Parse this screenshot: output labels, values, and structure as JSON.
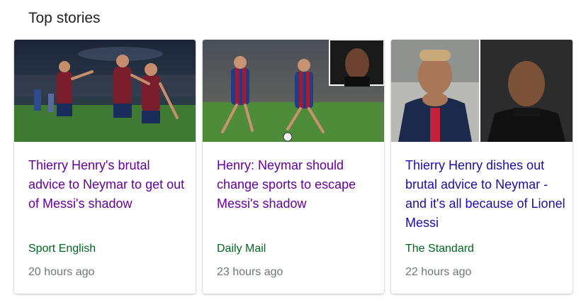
{
  "section": {
    "title": "Top stories"
  },
  "colors": {
    "visited_link": "#660099",
    "link": "#1a0dab",
    "source": "#006621",
    "meta": "#70757a"
  },
  "stories": [
    {
      "headline": "Thierry Henry's brutal advice to Neymar to get out of Messi's shadow",
      "source": "Sport English",
      "time": "20 hours ago",
      "visited": true
    },
    {
      "headline": "Henry: Neymar should change sports to escape Messi's shadow",
      "source": "Daily Mail",
      "time": "23 hours ago",
      "visited": true
    },
    {
      "headline": "Thierry Henry dishes out brutal advice to Neymar - and it's all because of Lionel Messi",
      "source": "The Standard",
      "time": "22 hours ago",
      "visited": false
    }
  ]
}
